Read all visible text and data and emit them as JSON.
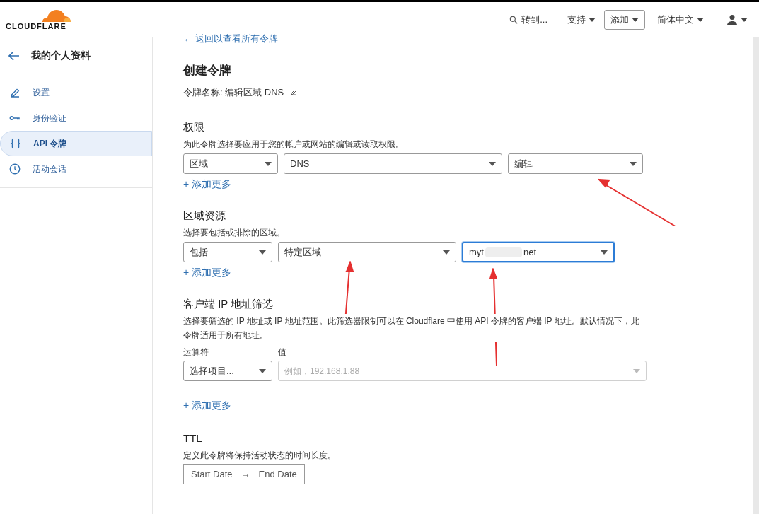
{
  "header": {
    "logo": "CLOUDFLARE",
    "search": "转到...",
    "menus": [
      {
        "label": "支持",
        "kind": "plain"
      },
      {
        "label": "添加",
        "kind": "outlined"
      },
      {
        "label": "简体中文",
        "kind": "plain"
      }
    ]
  },
  "sidebar": {
    "title": "我的个人资料",
    "items": [
      {
        "label": "设置",
        "selected": false
      },
      {
        "label": "身份验证",
        "selected": false
      },
      {
        "label": "API 令牌",
        "selected": true
      },
      {
        "label": "活动会话",
        "selected": false
      }
    ]
  },
  "back_link": "← 返回以查看所有令牌",
  "title": "创建令牌",
  "token_name": "令牌名称: 编辑区域 DNS",
  "permissions": {
    "heading": "权限",
    "description": "为此令牌选择要应用于您的帐户或网站的编辑或读取权限。",
    "selects": [
      {
        "value": "区域"
      },
      {
        "value": "DNS"
      },
      {
        "value": "编辑"
      }
    ],
    "add_more": "+ 添加更多"
  },
  "zone_resources": {
    "heading": "区域资源",
    "description": "选择要包括或排除的区域。",
    "selects": [
      {
        "value": "包括",
        "focused": false
      },
      {
        "value": "特定区域",
        "focused": false
      },
      {
        "value_start": "myt",
        "value_end": "net",
        "focused": true
      }
    ],
    "add_more": "+ 添加更多"
  },
  "ip_filter": {
    "heading": "客户端 IP 地址筛选",
    "description": "选择要筛选的 IP 地址或 IP 地址范围。此筛选器限制可以在 Cloudflare 中使用 API 令牌的客户端 IP 地址。默认情况下，此令牌适用于所有地址。",
    "operator_label": "运算符",
    "operator_value": "选择项目...",
    "value_label": "值",
    "value_placeholder": "例如，192.168.1.88",
    "value_disabled": true,
    "add_more": "+ 添加更多"
  },
  "ttl": {
    "heading": "TTL",
    "description": "定义此令牌将保持活动状态的时间长度。",
    "start": "Start Date",
    "arrow": "→",
    "end": "End Date"
  }
}
